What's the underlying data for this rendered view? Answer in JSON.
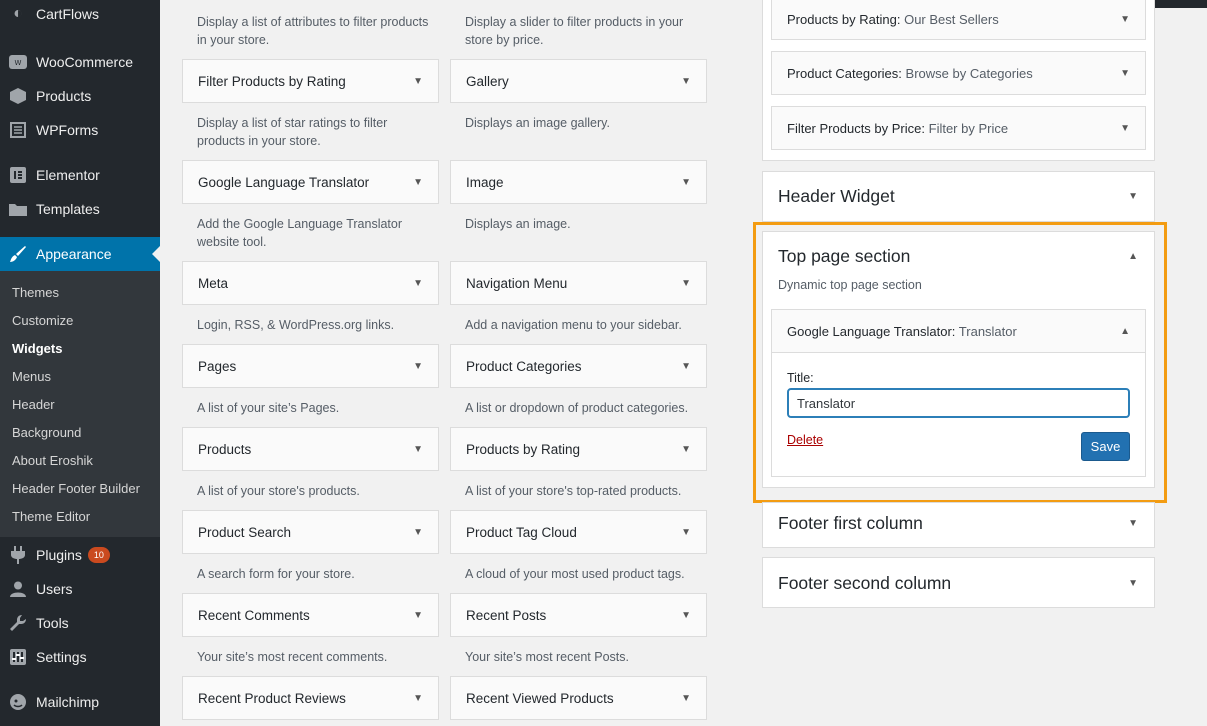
{
  "sidebar": {
    "menu": [
      {
        "label": "CartFlows",
        "icon": "cartflows-icon"
      },
      {
        "label": "WooCommerce",
        "icon": "woocommerce-icon"
      },
      {
        "label": "Products",
        "icon": "products-icon"
      },
      {
        "label": "WPForms",
        "icon": "wpforms-icon"
      },
      {
        "label": "Elementor",
        "icon": "elementor-icon"
      },
      {
        "label": "Templates",
        "icon": "folder-icon"
      },
      {
        "label": "Appearance",
        "icon": "brush-icon"
      },
      {
        "label": "Plugins",
        "icon": "plug-icon",
        "badge": "10"
      },
      {
        "label": "Users",
        "icon": "user-icon"
      },
      {
        "label": "Tools",
        "icon": "wrench-icon"
      },
      {
        "label": "Settings",
        "icon": "settings-icon"
      },
      {
        "label": "Mailchimp",
        "icon": "mailchimp-icon"
      }
    ],
    "submenu": [
      "Themes",
      "Customize",
      "Widgets",
      "Menus",
      "Header",
      "Background",
      "About Eroshik",
      "Header Footer Builder",
      "Theme Editor"
    ]
  },
  "available": {
    "top_descs": [
      "Display a list of attributes to filter products in your store.",
      "Display a slider to filter products in your store by price."
    ],
    "left": [
      {
        "title": "Filter Products by Rating",
        "desc": "Display a list of star ratings to filter products in your store."
      },
      {
        "title": "Google Language Translator",
        "desc": "Add the Google Language Translator website tool."
      },
      {
        "title": "Meta",
        "desc": "Login, RSS, & WordPress.org links."
      },
      {
        "title": "Pages",
        "desc": "A list of your site’s Pages."
      },
      {
        "title": "Products",
        "desc": "A list of your store's products."
      },
      {
        "title": "Product Search",
        "desc": "A search form for your store."
      },
      {
        "title": "Recent Comments",
        "desc": "Your site’s most recent comments."
      },
      {
        "title": "Recent Product Reviews",
        "desc": ""
      }
    ],
    "right": [
      {
        "title": "Gallery",
        "desc": "Displays an image gallery."
      },
      {
        "title": "Image",
        "desc": "Displays an image."
      },
      {
        "title": "Navigation Menu",
        "desc": "Add a navigation menu to your sidebar."
      },
      {
        "title": "Product Categories",
        "desc": "A list or dropdown of product categories."
      },
      {
        "title": "Products by Rating",
        "desc": "A list of your store's top-rated products."
      },
      {
        "title": "Product Tag Cloud",
        "desc": "A cloud of your most used product tags."
      },
      {
        "title": "Recent Posts",
        "desc": "Your site’s most recent Posts."
      },
      {
        "title": "Recent Viewed Products",
        "desc": ""
      }
    ]
  },
  "areas": {
    "top_widgets": [
      {
        "name": "Products by Rating:",
        "subtitle": "Our Best Sellers"
      },
      {
        "name": "Product Categories:",
        "subtitle": "Browse by Categories"
      },
      {
        "name": "Filter Products by Price:",
        "subtitle": "Filter by Price"
      }
    ],
    "header_widget": "Header Widget",
    "top_page_section": {
      "title": "Top page section",
      "desc": "Dynamic top page section",
      "widget_name": "Google Language Translator:",
      "widget_subtitle": "Translator",
      "field_label": "Title:",
      "field_value": "Translator",
      "delete_label": "Delete",
      "save_label": "Save"
    },
    "footer_first": "Footer first column",
    "footer_second": "Footer second column"
  },
  "colors": {
    "sidebar_bg": "#23282d",
    "active_menu": "#0073aa",
    "highlight": "#f39c12",
    "save_button": "#2271b1",
    "delete_link": "#aa0000",
    "badge": "#ca4a1f"
  }
}
